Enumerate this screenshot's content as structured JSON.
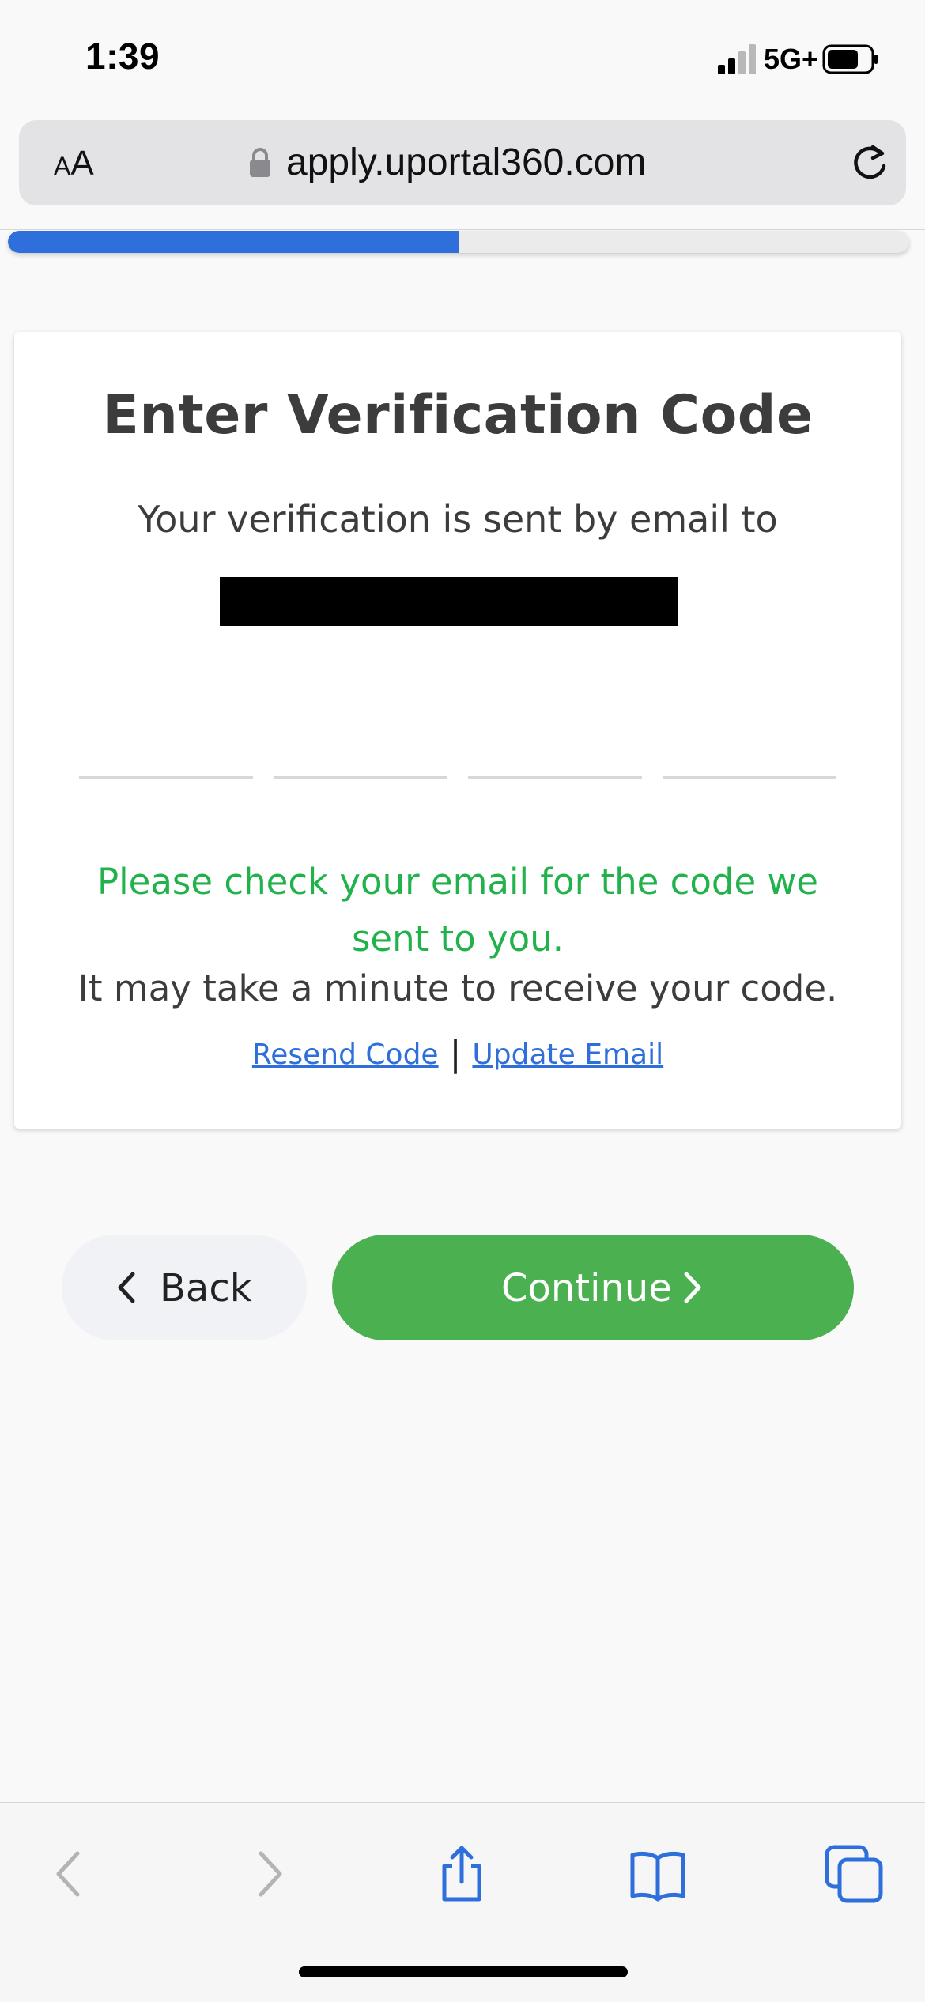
{
  "status_bar": {
    "time": "1:39",
    "network": "5G+"
  },
  "browser": {
    "aa_small": "A",
    "aa_big": "A",
    "url": "apply.uportal360.com"
  },
  "progress": {
    "fraction": 0.5,
    "fill_color": "#2f6fdc"
  },
  "card": {
    "title": "Enter Verification Code",
    "subtitle": "Your verification is sent by email to",
    "code_digits": [
      "",
      "",
      "",
      ""
    ],
    "green_message": "Please check your email for the code we sent to you.",
    "info_message": "It may take a minute to receive your code.",
    "resend_link": "Resend Code",
    "separator": "|",
    "update_link": "Update Email"
  },
  "actions": {
    "back_label": "Back",
    "continue_label": "Continue"
  },
  "colors": {
    "accent_blue": "#2f6fdc",
    "success_green": "#22b24c",
    "continue_green": "#4bb050"
  },
  "toolbar_icons": [
    "back-arrow-icon",
    "forward-arrow-icon",
    "share-icon",
    "bookmarks-icon",
    "tabs-icon"
  ]
}
